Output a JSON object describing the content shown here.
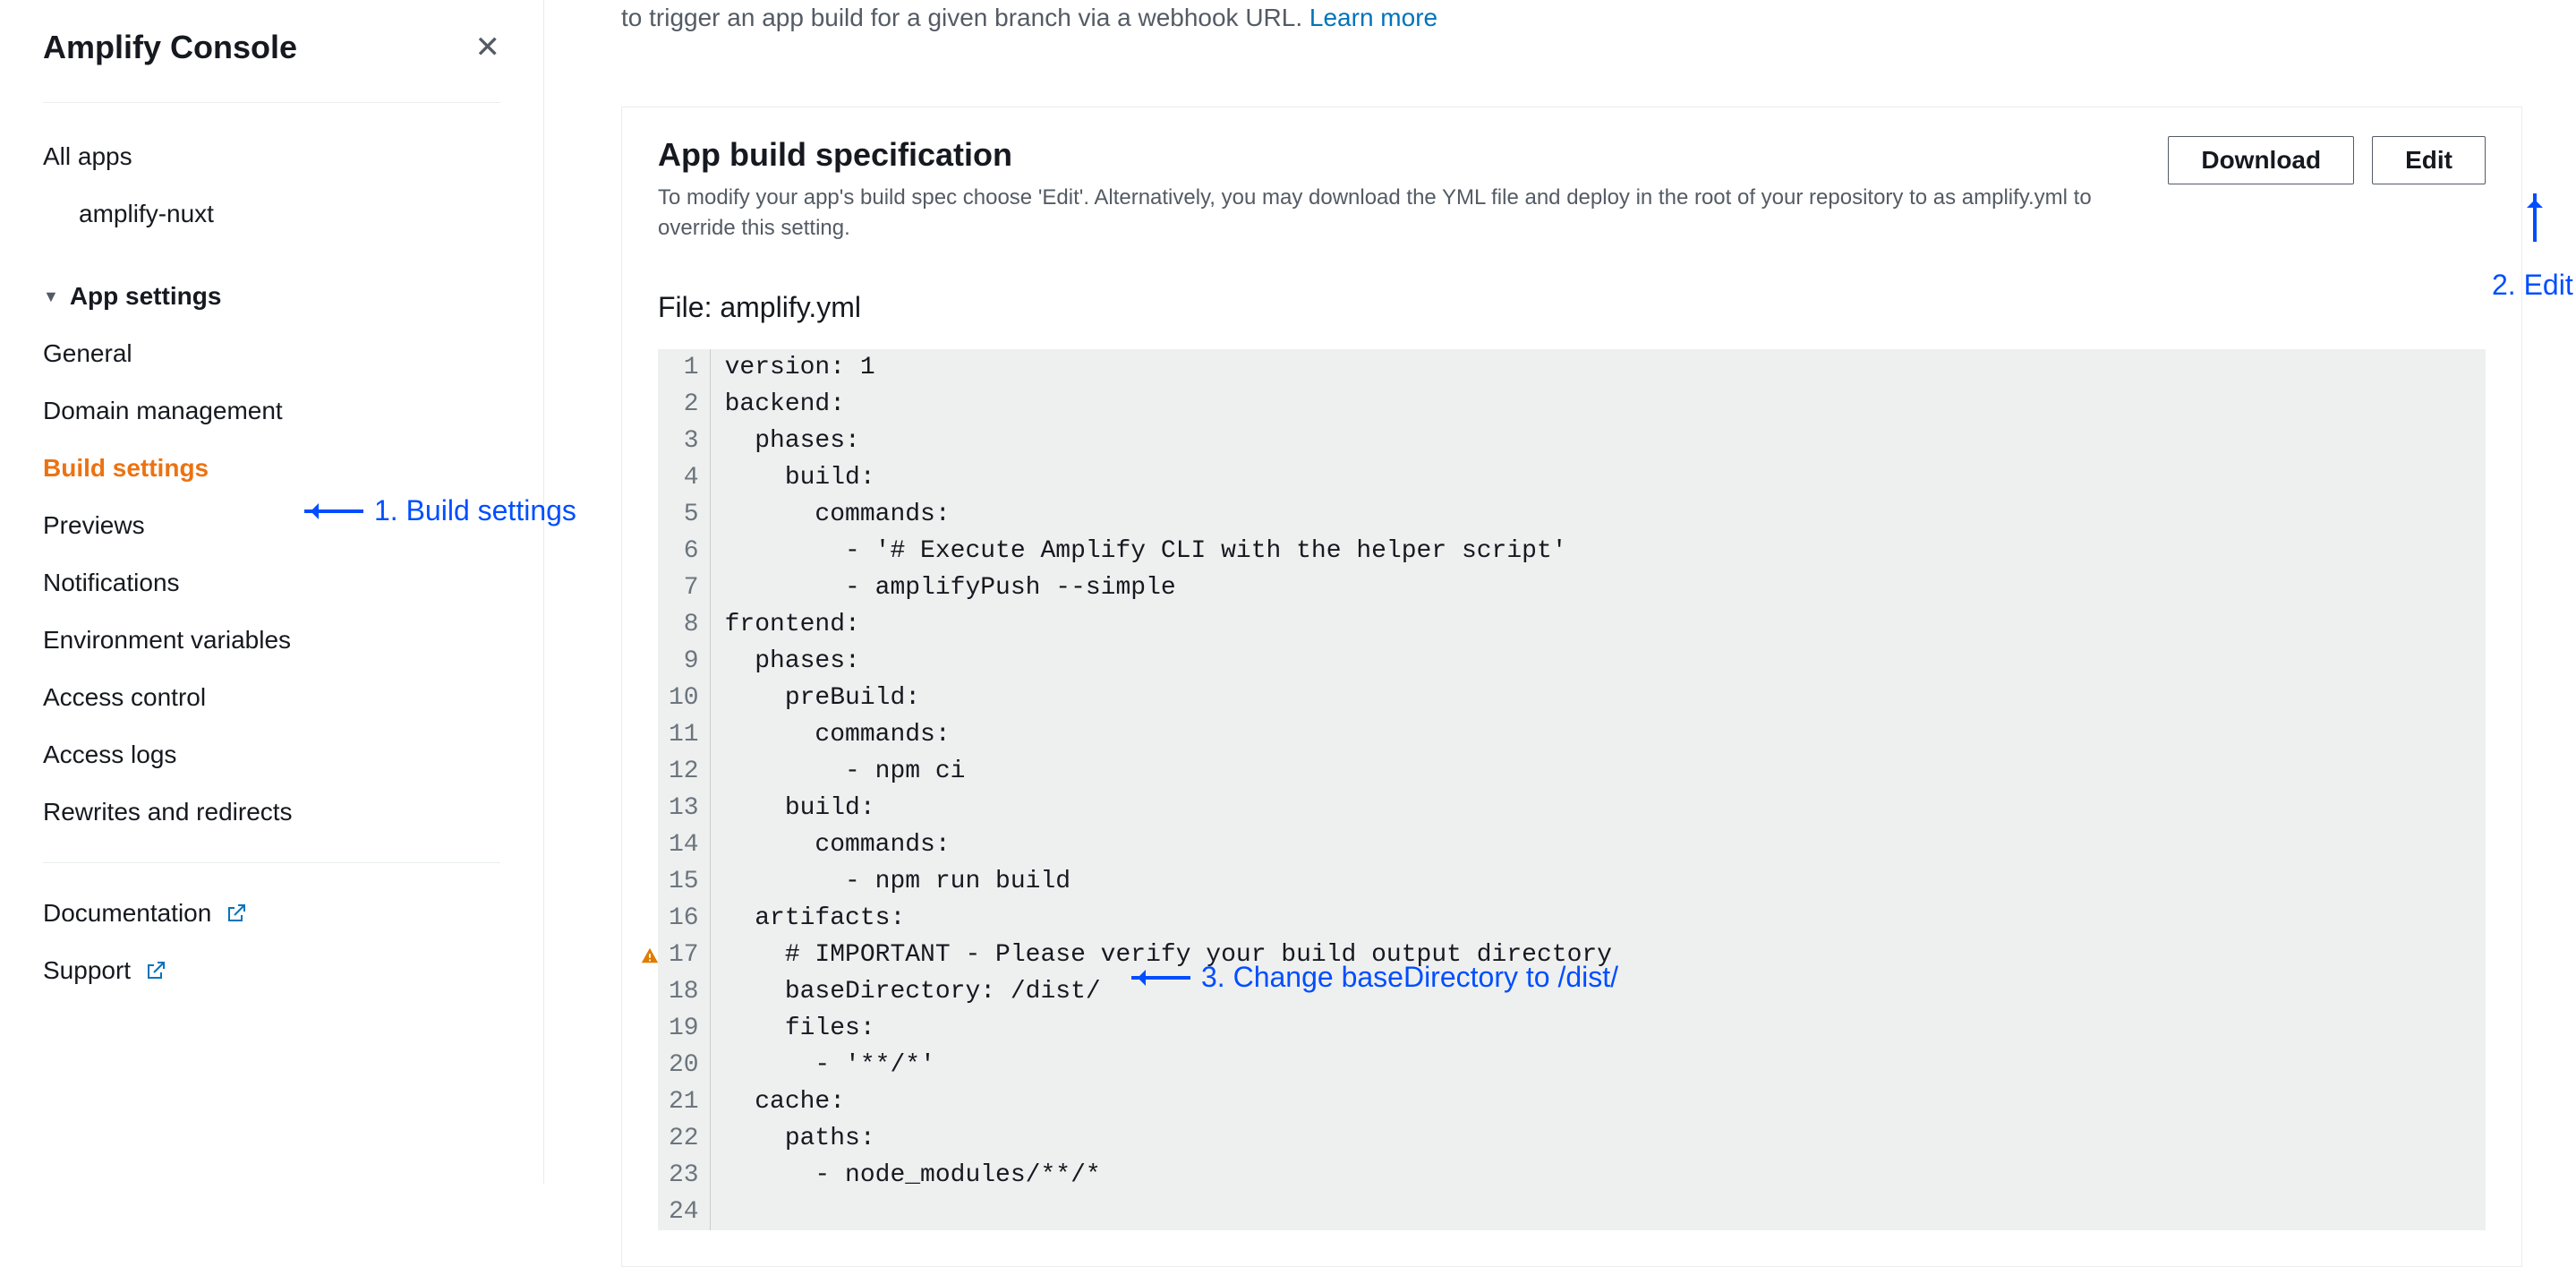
{
  "sidebar": {
    "title": "Amplify Console",
    "all_apps": "All apps",
    "app_name": "amplify-nuxt",
    "section_label": "App settings",
    "items": [
      "General",
      "Domain management",
      "Build settings",
      "Previews",
      "Notifications",
      "Environment variables",
      "Access control",
      "Access logs",
      "Rewrites and redirects"
    ],
    "active_index": 2,
    "doc_label": "Documentation",
    "support_label": "Support"
  },
  "banner": {
    "text_fragment": "to trigger an app build for a given branch via a webhook URL. ",
    "link": "Learn more"
  },
  "panel": {
    "title": "App build specification",
    "description": "To modify your app's build spec choose 'Edit'. Alternatively, you may download the YML file and deploy in the root of your repository to as amplify.yml to override this setting.",
    "download_label": "Download",
    "edit_label": "Edit",
    "file_label": "File: amplify.yml"
  },
  "code": {
    "lines": [
      "version: 1",
      "backend:",
      "  phases:",
      "    build:",
      "      commands:",
      "        - '# Execute Amplify CLI with the helper script'",
      "        - amplifyPush --simple",
      "frontend:",
      "  phases:",
      "    preBuild:",
      "      commands:",
      "        - npm ci",
      "    build:",
      "      commands:",
      "        - npm run build",
      "  artifacts:",
      "    # IMPORTANT - Please verify your build output directory",
      "    baseDirectory: /dist/",
      "    files:",
      "      - '**/*'",
      "  cache:",
      "    paths:",
      "      - node_modules/**/*",
      ""
    ],
    "line_count": 24,
    "warning_line": 17
  },
  "annotations": {
    "a1": "1. Build settings",
    "a2": "2. Edit",
    "a3": "3. Change baseDirectory to /dist/"
  }
}
